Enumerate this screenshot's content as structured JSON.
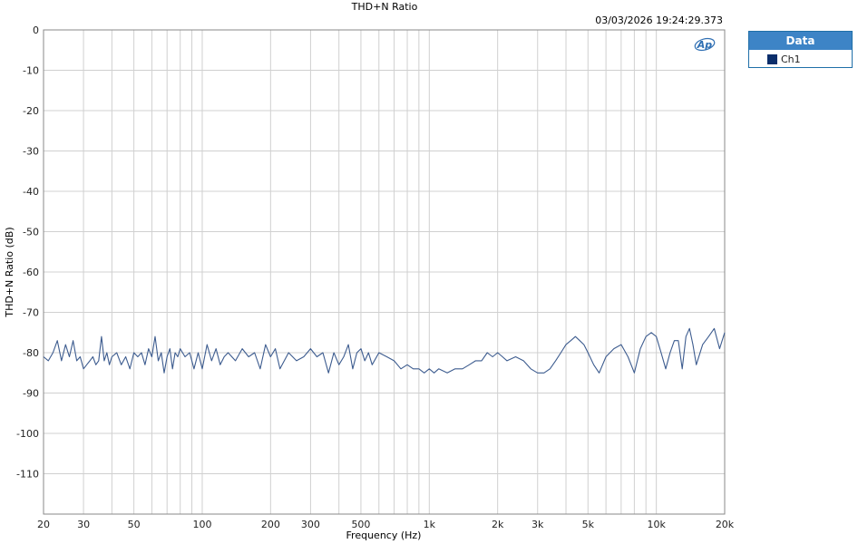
{
  "timestamp": "03/03/2026 19:24:29.373",
  "legend": {
    "header": "Data",
    "entries": [
      "Ch1"
    ]
  },
  "colors": {
    "series": "#3d5c8f",
    "grid": "#d0d0d0",
    "legend_header": "#3d84c6",
    "swatch": "#0b2e6b",
    "logo": "#2f6fb3"
  },
  "logo_icon": "ap-logo-icon",
  "chart_data": {
    "type": "line",
    "title": "THD+N Ratio",
    "xlabel": "Frequency (Hz)",
    "ylabel": "THD+N Ratio (dB)",
    "xscale": "log",
    "xlim": [
      20,
      20000
    ],
    "ylim": [
      -120,
      0
    ],
    "grid": true,
    "legend_position": "outside-right",
    "x_ticks": [
      20,
      30,
      50,
      100,
      200,
      300,
      500,
      1000,
      2000,
      3000,
      5000,
      10000,
      20000
    ],
    "x_tick_labels": [
      "20",
      "30",
      "50",
      "100",
      "200",
      "300",
      "500",
      "1k",
      "2k",
      "3k",
      "5k",
      "10k",
      "20k"
    ],
    "y_ticks": [
      0,
      -10,
      -20,
      -30,
      -40,
      -50,
      -60,
      -70,
      -80,
      -90,
      -100,
      -110
    ],
    "y_tick_labels": [
      "0",
      "-10",
      "-20",
      "-30",
      "-40",
      "-50",
      "-60",
      "-70",
      "-80",
      "-90",
      "-100",
      "-110"
    ],
    "series": [
      {
        "name": "Ch1",
        "x": [
          20,
          21,
          22,
          23,
          24,
          25,
          26,
          27,
          28,
          29,
          30,
          31,
          32,
          33,
          34,
          35,
          36,
          37,
          38,
          39,
          40,
          42,
          44,
          46,
          48,
          50,
          52,
          54,
          56,
          58,
          60,
          62,
          64,
          66,
          68,
          70,
          72,
          74,
          76,
          78,
          80,
          84,
          88,
          92,
          96,
          100,
          105,
          110,
          115,
          120,
          125,
          130,
          140,
          150,
          160,
          170,
          180,
          190,
          200,
          210,
          220,
          240,
          260,
          280,
          300,
          320,
          340,
          360,
          380,
          400,
          420,
          440,
          460,
          480,
          500,
          520,
          540,
          560,
          600,
          650,
          700,
          750,
          800,
          850,
          900,
          950,
          1000,
          1050,
          1100,
          1200,
          1300,
          1400,
          1500,
          1600,
          1700,
          1800,
          1900,
          2000,
          2100,
          2200,
          2400,
          2600,
          2800,
          3000,
          3200,
          3400,
          3600,
          3800,
          4000,
          4200,
          4400,
          4600,
          4800,
          5000,
          5300,
          5600,
          6000,
          6500,
          7000,
          7500,
          8000,
          8500,
          9000,
          9500,
          10000,
          10500,
          11000,
          11500,
          12000,
          12500,
          13000,
          13500,
          14000,
          14500,
          15000,
          16000,
          17000,
          18000,
          19000,
          20000
        ],
        "y": [
          -81,
          -82,
          -80,
          -77,
          -82,
          -78,
          -81,
          -77,
          -82,
          -81,
          -84,
          -83,
          -82,
          -81,
          -83,
          -82,
          -76,
          -82,
          -80,
          -83,
          -81,
          -80,
          -83,
          -81,
          -84,
          -80,
          -81,
          -80,
          -83,
          -79,
          -81,
          -76,
          -82,
          -80,
          -85,
          -81,
          -79,
          -84,
          -80,
          -81,
          -79,
          -81,
          -80,
          -84,
          -80,
          -84,
          -78,
          -82,
          -79,
          -83,
          -81,
          -80,
          -82,
          -79,
          -81,
          -80,
          -84,
          -78,
          -81,
          -79,
          -84,
          -80,
          -82,
          -81,
          -79,
          -81,
          -80,
          -85,
          -80,
          -83,
          -81,
          -78,
          -84,
          -80,
          -79,
          -82,
          -80,
          -83,
          -80,
          -81,
          -82,
          -84,
          -83,
          -84,
          -84,
          -85,
          -84,
          -85,
          -84,
          -85,
          -84,
          -84,
          -83,
          -82,
          -82,
          -80,
          -81,
          -80,
          -81,
          -82,
          -81,
          -82,
          -84,
          -85,
          -85,
          -84,
          -82,
          -80,
          -78,
          -77,
          -76,
          -77,
          -78,
          -80,
          -83,
          -85,
          -81,
          -79,
          -78,
          -81,
          -85,
          -79,
          -76,
          -75,
          -76,
          -80,
          -84,
          -80,
          -77,
          -77,
          -84,
          -76,
          -74,
          -78,
          -83,
          -78,
          -76,
          -74,
          -79,
          -75
        ]
      }
    ]
  }
}
